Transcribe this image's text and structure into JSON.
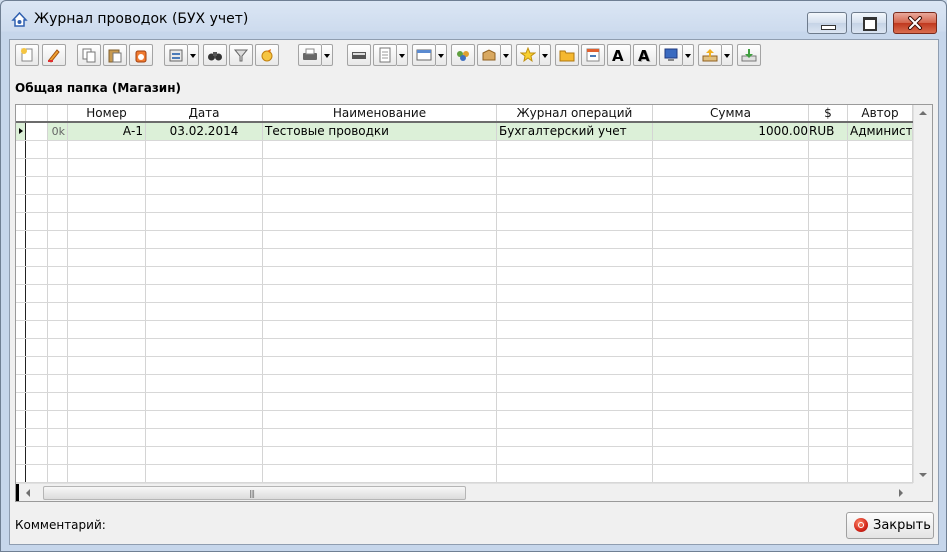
{
  "window": {
    "title": "Журнал проводок (БУХ учет)"
  },
  "toolbar": {
    "buttons": [
      "new-doc-icon",
      "edit-pencil-icon",
      "copy-icon",
      "paste-icon",
      "delete-icon",
      "report-icon",
      "binoculars-icon",
      "filter-icon",
      "refresh-icon",
      "printer-icon",
      "scanner-icon",
      "page-icon",
      "view-icon",
      "people-icon",
      "box-icon",
      "star-icon",
      "folder-icon",
      "layout-icon",
      "font-bold-a-icon",
      "font-shadow-a-icon",
      "computer-icon",
      "export-icon",
      "import-icon"
    ]
  },
  "folder": {
    "title": "Общая папка (Магазин)"
  },
  "grid": {
    "columns": [
      "",
      "",
      "Номер",
      "Дата",
      "Наименование",
      "Журнал операций",
      "Сумма",
      "$",
      "Автор"
    ],
    "rows": [
      {
        "status": "0k",
        "number": "А-1",
        "date": "03.02.2014",
        "name": "Тестовые проводки",
        "journal": "Бухгалтерский учет",
        "sum": "1000.00",
        "currency": "RUB",
        "author": "Админист"
      }
    ],
    "hscroll_grip": "|||"
  },
  "footer": {
    "comment_label": "Комментарий:",
    "close_label": "Закрыть"
  }
}
